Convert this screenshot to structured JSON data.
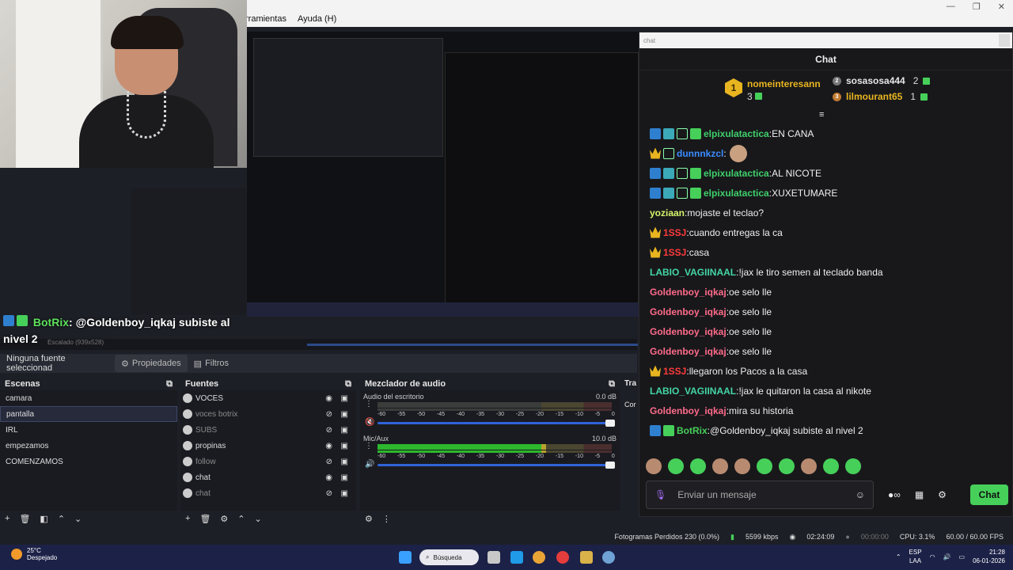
{
  "menu": {
    "tools": "rramientas",
    "help": "Ayuda (H)"
  },
  "overlay": {
    "bot_name": "BotRix",
    "bot_message": ": @Goldenboy_iqkaj subiste al nivel 2"
  },
  "scale_text": "Escalado (939x528)",
  "properties_bar": {
    "selected": "Ninguna fuente seleccionad",
    "properties": "Propiedades",
    "filters": "Filtros"
  },
  "scenes": {
    "title": "Escenas",
    "items": [
      "camara",
      "pantalla",
      "IRL",
      "empezamos",
      "COMENZAMOS"
    ],
    "active": 1
  },
  "sources": {
    "title": "Fuentes",
    "items": [
      {
        "label": "VOCES",
        "dim": false
      },
      {
        "label": "voces botrix",
        "dim": true
      },
      {
        "label": "SUBS",
        "dim": true
      },
      {
        "label": "propinas",
        "dim": false
      },
      {
        "label": "follow",
        "dim": true
      },
      {
        "label": "chat",
        "dim": false
      },
      {
        "label": "chat",
        "dim": true
      }
    ]
  },
  "mixer": {
    "title": "Mezclador de audio",
    "channels": [
      {
        "name": "Audio del escritorio",
        "db": "0.0 dB",
        "level": 0.0,
        "volume": 1.0
      },
      {
        "name": "Mic/Aux",
        "db": "10.0 dB",
        "level": 0.72,
        "volume": 1.0
      }
    ],
    "ticks": [
      "-60",
      "-55",
      "-50",
      "-45",
      "-40",
      "-35",
      "-30",
      "-25",
      "-20",
      "-15",
      "-10",
      "-5",
      "0"
    ]
  },
  "transitions": {
    "title": "Tra",
    "value": "Cor"
  },
  "chat": {
    "window_title": "chat",
    "header": "Chat",
    "leaderboard": [
      {
        "rank": "1",
        "name": "nomeinteresann",
        "count": "3",
        "color": "#e8b520"
      },
      {
        "rank": "2",
        "name": "sosasosa444",
        "count": "2",
        "color": "#e6e6e6"
      },
      {
        "rank": "3",
        "name": "lilmourant65",
        "count": "1",
        "color": "#e8b520"
      }
    ],
    "messages": [
      {
        "badges": [
          "blue",
          "teal",
          "ghost",
          "green"
        ],
        "user": "elpixulatactica",
        "color": "#3fd06b",
        "text": "EN CANA"
      },
      {
        "badges": [
          "crown",
          "ghost"
        ],
        "user": "dunnnkzcl",
        "color": "#3b8cff",
        "text": "",
        "face": true
      },
      {
        "badges": [
          "blue",
          "teal",
          "ghost",
          "green"
        ],
        "user": "elpixulatactica",
        "color": "#3fd06b",
        "text": "AL NICOTE"
      },
      {
        "badges": [
          "blue",
          "teal",
          "ghost",
          "green"
        ],
        "user": "elpixulatactica",
        "color": "#3fd06b",
        "text": "XUXETUMARE"
      },
      {
        "badges": [],
        "user": "yoziaan",
        "color": "#d4f36b",
        "text": "mojaste el teclao?"
      },
      {
        "badges": [
          "crown"
        ],
        "user": "1SSJ",
        "color": "#ff3b3b",
        "text": "cuando entregas la ca"
      },
      {
        "badges": [
          "crown"
        ],
        "user": "1SSJ",
        "color": "#ff3b3b",
        "text": "casa"
      },
      {
        "badges": [],
        "user": "LABIO_VAGIINAAL",
        "color": "#44d6a3",
        "text": "!jax le tiro semen al teclado banda"
      },
      {
        "badges": [],
        "user": "Goldenboy_iqkaj",
        "color": "#ff6b8a",
        "text": "oe selo lle"
      },
      {
        "badges": [],
        "user": "Goldenboy_iqkaj",
        "color": "#ff6b8a",
        "text": "oe selo lle"
      },
      {
        "badges": [],
        "user": "Goldenboy_iqkaj",
        "color": "#ff6b8a",
        "text": "oe selo lle"
      },
      {
        "badges": [],
        "user": "Goldenboy_iqkaj",
        "color": "#ff6b8a",
        "text": "oe selo lle"
      },
      {
        "badges": [
          "crown"
        ],
        "user": "1SSJ",
        "color": "#ff3b3b",
        "text": "llegaron los Pacos a la casa"
      },
      {
        "badges": [],
        "user": "LABIO_VAGIINAAL",
        "color": "#44d6a3",
        "text": "!jax le quitaron la casa al nikote"
      },
      {
        "badges": [],
        "user": "Goldenboy_iqkaj",
        "color": "#ff6b8a",
        "text": "mira su historia"
      },
      {
        "badges": [
          "blue",
          "green"
        ],
        "user": "BotRix",
        "color": "#46d05a",
        "text": "@Goldenboy_iqkaj subiste al nivel 2"
      }
    ],
    "input_placeholder": "Enviar un mensaje",
    "send_label": "Chat"
  },
  "status": {
    "dropped": "Fotogramas Perdidos 230 (0.0%)",
    "bitrate": "5599 kbps",
    "stream_time": "02:24:09",
    "rec_time": "00:00:00",
    "cpu": "CPU: 3.1%",
    "fps": "60.00 / 60.00 FPS"
  },
  "taskbar": {
    "temp": "25°C",
    "weather": "Despejado",
    "search": "Búsqueda",
    "lang1": "ESP",
    "lang2": "LAA",
    "time": "21:28",
    "date": "06-01-2026"
  }
}
